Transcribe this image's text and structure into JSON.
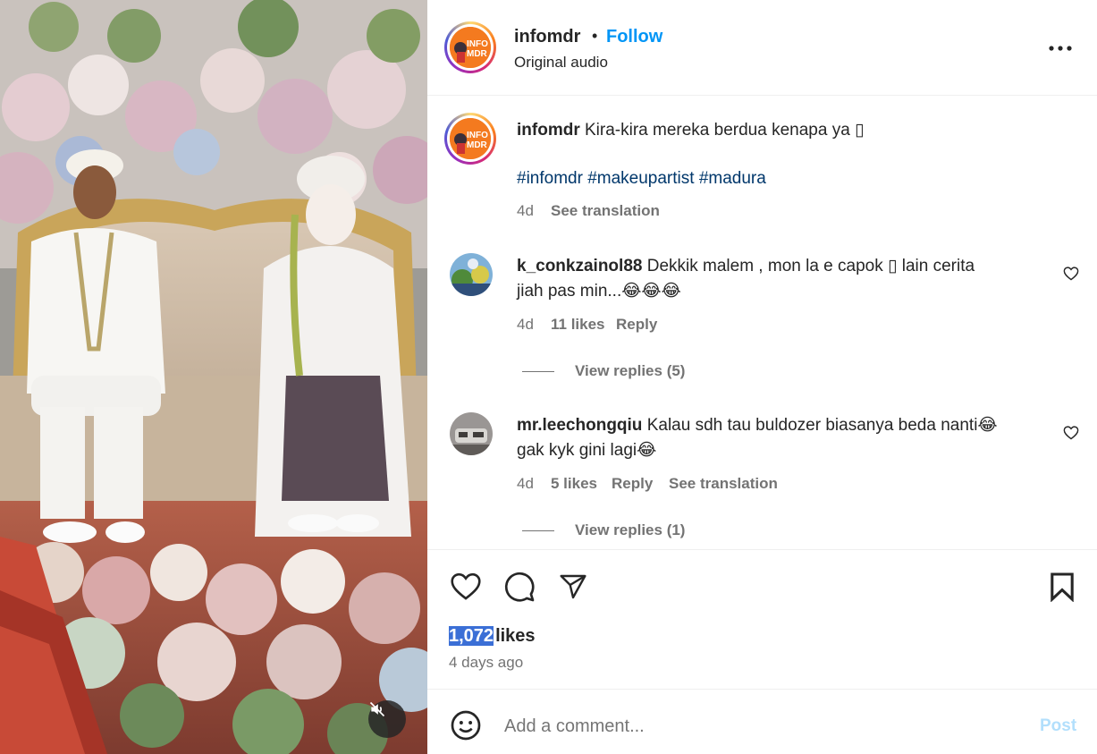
{
  "post": {
    "username": "infomdr",
    "follow_label": "Follow",
    "dot": "•",
    "audio": "Original audio",
    "more_icon": "more-horizontal-icon",
    "avatar_text_top": "INFO",
    "avatar_text_bottom": "MDR"
  },
  "caption": {
    "username": "infomdr",
    "text": "Kira-kira mereka berdua kenapa ya ▯",
    "hashtags": [
      "#infomdr",
      "#makeupartist",
      "#madura"
    ],
    "time": "4d",
    "translation_label": "See translation"
  },
  "comments": [
    {
      "username": "k_conkzainol88",
      "text_line1": "Dekkik malem , mon la e capok ▯ lain cerita",
      "text_line2": "jiah pas min...😂😂😂",
      "time": "4d",
      "likes": "11 likes",
      "reply_label": "Reply",
      "view_replies": "View replies (5)"
    },
    {
      "username": "mr.leechongqiu",
      "text_line1": "Kalau sdh tau buldozer biasanya beda nanti😂",
      "text_line2": "gak kyk gini lagi😂",
      "time": "4d",
      "likes": "5 likes",
      "reply_label": "Reply",
      "translation_label": "See translation",
      "view_replies": "View replies (1)"
    }
  ],
  "actions": {
    "like_icon": "heart-icon",
    "comment_icon": "comment-icon",
    "share_icon": "send-icon",
    "save_icon": "bookmark-icon"
  },
  "stats": {
    "likes_count": "1,072",
    "likes_label": "likes",
    "date": "4 days ago"
  },
  "composer": {
    "emoji_icon": "smiley-icon",
    "placeholder": "Add a comment...",
    "post_label": "Post"
  },
  "media": {
    "mute_icon": "muted-speaker-icon"
  },
  "colors": {
    "link": "#0095f6",
    "hashtag": "#00376b",
    "muted": "#737373",
    "selection": "#3b6fd6",
    "post_disabled": "#b2dffc"
  }
}
